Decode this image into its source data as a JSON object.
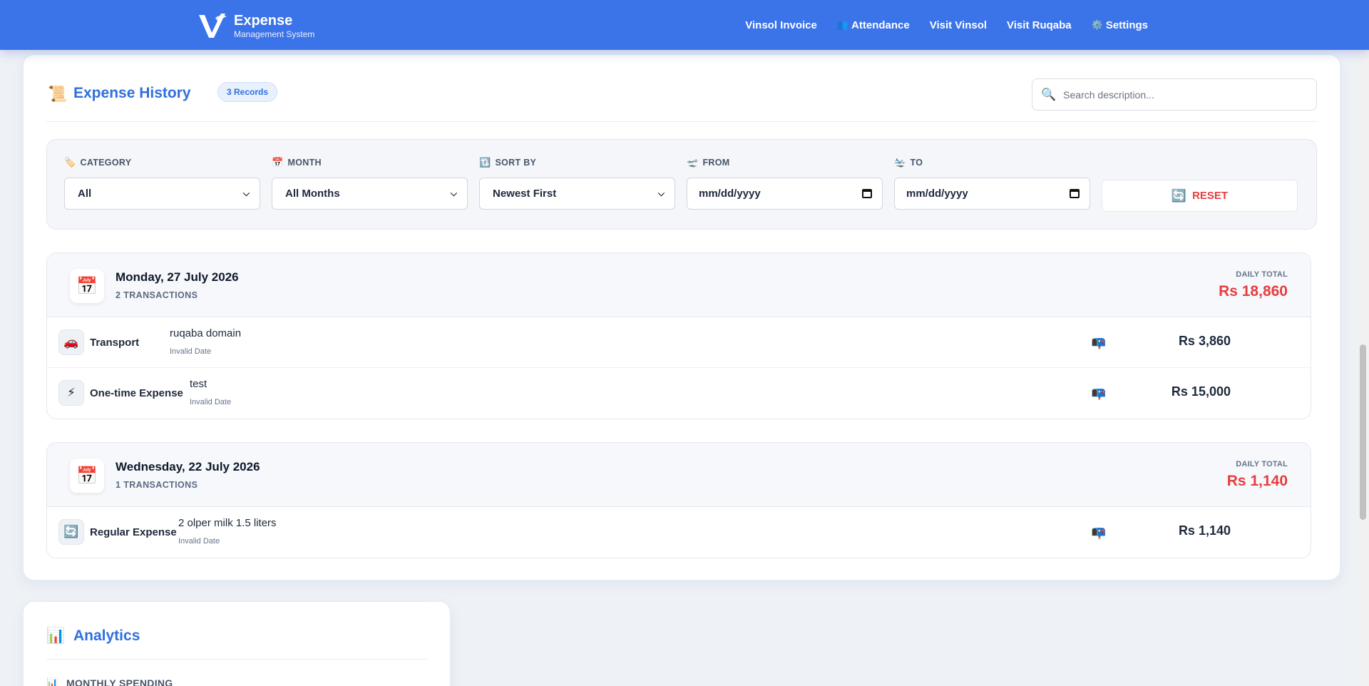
{
  "brand": {
    "title": "Expense",
    "subtitle": "Management System"
  },
  "nav": [
    {
      "label": "Vinsol Invoice",
      "icon": ""
    },
    {
      "label": "Attendance",
      "icon": "👥"
    },
    {
      "label": "Visit Vinsol",
      "icon": ""
    },
    {
      "label": "Visit Ruqaba",
      "icon": ""
    },
    {
      "label": "Settings",
      "icon": "⚙️"
    }
  ],
  "history": {
    "icon": "📜",
    "title": "Expense History",
    "badge": "3 Records",
    "search_placeholder": "Search description...",
    "search_icon": "🔍"
  },
  "filters": {
    "category": {
      "label": "CATEGORY",
      "icon": "🏷️",
      "value": "All"
    },
    "month": {
      "label": "MONTH",
      "icon": "📅",
      "value": "All Months"
    },
    "sort": {
      "label": "SORT BY",
      "icon": "🔃",
      "value": "Newest First"
    },
    "from": {
      "label": "FROM",
      "icon": "🛫",
      "value": "mm/dd/yyyy"
    },
    "to": {
      "label": "TO",
      "icon": "🛬",
      "value": "mm/dd/yyyy"
    },
    "reset": {
      "label": "RESET",
      "icon": "🔄"
    }
  },
  "days": [
    {
      "icon": "📅",
      "date": "Monday, 27 July 2026",
      "count": "2 TRANSACTIONS",
      "total_label": "DAILY TOTAL",
      "total": "Rs 18,860",
      "items": [
        {
          "icon": "🚗",
          "category": "Transport",
          "description": "ruqaba domain",
          "sub": "Invalid Date",
          "receipt_icon": "📭",
          "amount": "Rs 3,860"
        },
        {
          "icon": "⚡",
          "category": "One-time Expense",
          "description": "test",
          "sub": "Invalid Date",
          "receipt_icon": "📭",
          "amount": "Rs 15,000"
        }
      ]
    },
    {
      "icon": "📅",
      "date": "Wednesday, 22 July 2026",
      "count": "1 TRANSACTIONS",
      "total_label": "DAILY TOTAL",
      "total": "Rs 1,140",
      "items": [
        {
          "icon": "🔄",
          "category": "Regular Expense",
          "description": "2 olper milk 1.5 liters",
          "sub": "Invalid Date",
          "receipt_icon": "📭",
          "amount": "Rs 1,140"
        }
      ]
    }
  ],
  "analytics": {
    "icon": "📊",
    "title": "Analytics",
    "monthly_icon": "📊",
    "monthly_label": "MONTHLY SPENDING"
  },
  "colors": {
    "primary": "#3b73e8",
    "title_blue": "#2f6fdf",
    "danger": "#e53e3e"
  }
}
